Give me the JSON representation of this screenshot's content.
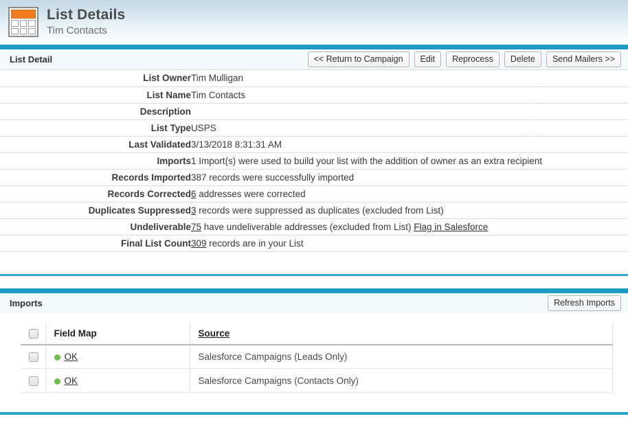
{
  "header": {
    "icon": "grid-table-icon",
    "title": "List Details",
    "subtitle": "Tim Contacts",
    "accent_orange": "#f07d20",
    "accent_teal": "#1f9cc4"
  },
  "list_detail_section": {
    "title": "List Detail",
    "buttons": [
      {
        "name": "return-to-campaign",
        "label": "<< Return to Campaign"
      },
      {
        "name": "edit",
        "label": "Edit"
      },
      {
        "name": "reprocess",
        "label": "Reprocess"
      },
      {
        "name": "delete",
        "label": "Delete"
      },
      {
        "name": "send-mailers",
        "label": "Send Mailers >>"
      }
    ],
    "fields": [
      {
        "label": "List Owner",
        "value": "Tim Mulligan"
      },
      {
        "label": "List Name",
        "value": "Tim Contacts"
      },
      {
        "label": "Description",
        "value": ""
      },
      {
        "label": "List Type",
        "value": "USPS"
      },
      {
        "label": "Last Validated",
        "value": "3/13/2018 8:31:31 AM"
      },
      {
        "label": "Imports",
        "value": "1 Import(s) were used to build your list with the addition of owner as an extra recipient"
      },
      {
        "label": "Records Imported",
        "value": "387 records were successfully imported"
      },
      {
        "label": "Records Corrected",
        "link": "6",
        "value": " addresses were corrected"
      },
      {
        "label": "Duplicates Suppressed",
        "link": "3",
        "value": " records were suppressed as duplicates (excluded from List)"
      },
      {
        "label": "Undeliverable",
        "link": "75",
        "value": " have undeliverable addresses (excluded from List) ",
        "link2": "Flag in Salesforce"
      },
      {
        "label": "Final List Count",
        "link": "309",
        "value": " records are in your List"
      }
    ]
  },
  "imports_section": {
    "title": "Imports",
    "refresh_label": "Refresh Imports",
    "columns": [
      {
        "name": "select-all",
        "label": ""
      },
      {
        "name": "field-map",
        "label": "Field Map"
      },
      {
        "name": "source",
        "label": "Source",
        "sortable": true
      }
    ],
    "rows": [
      {
        "status": "OK",
        "status_color": "#6cc247",
        "source": "Salesforce Campaigns (Leads Only)"
      },
      {
        "status": "OK",
        "status_color": "#6cc247",
        "source": "Salesforce Campaigns (Contacts Only)"
      }
    ]
  }
}
